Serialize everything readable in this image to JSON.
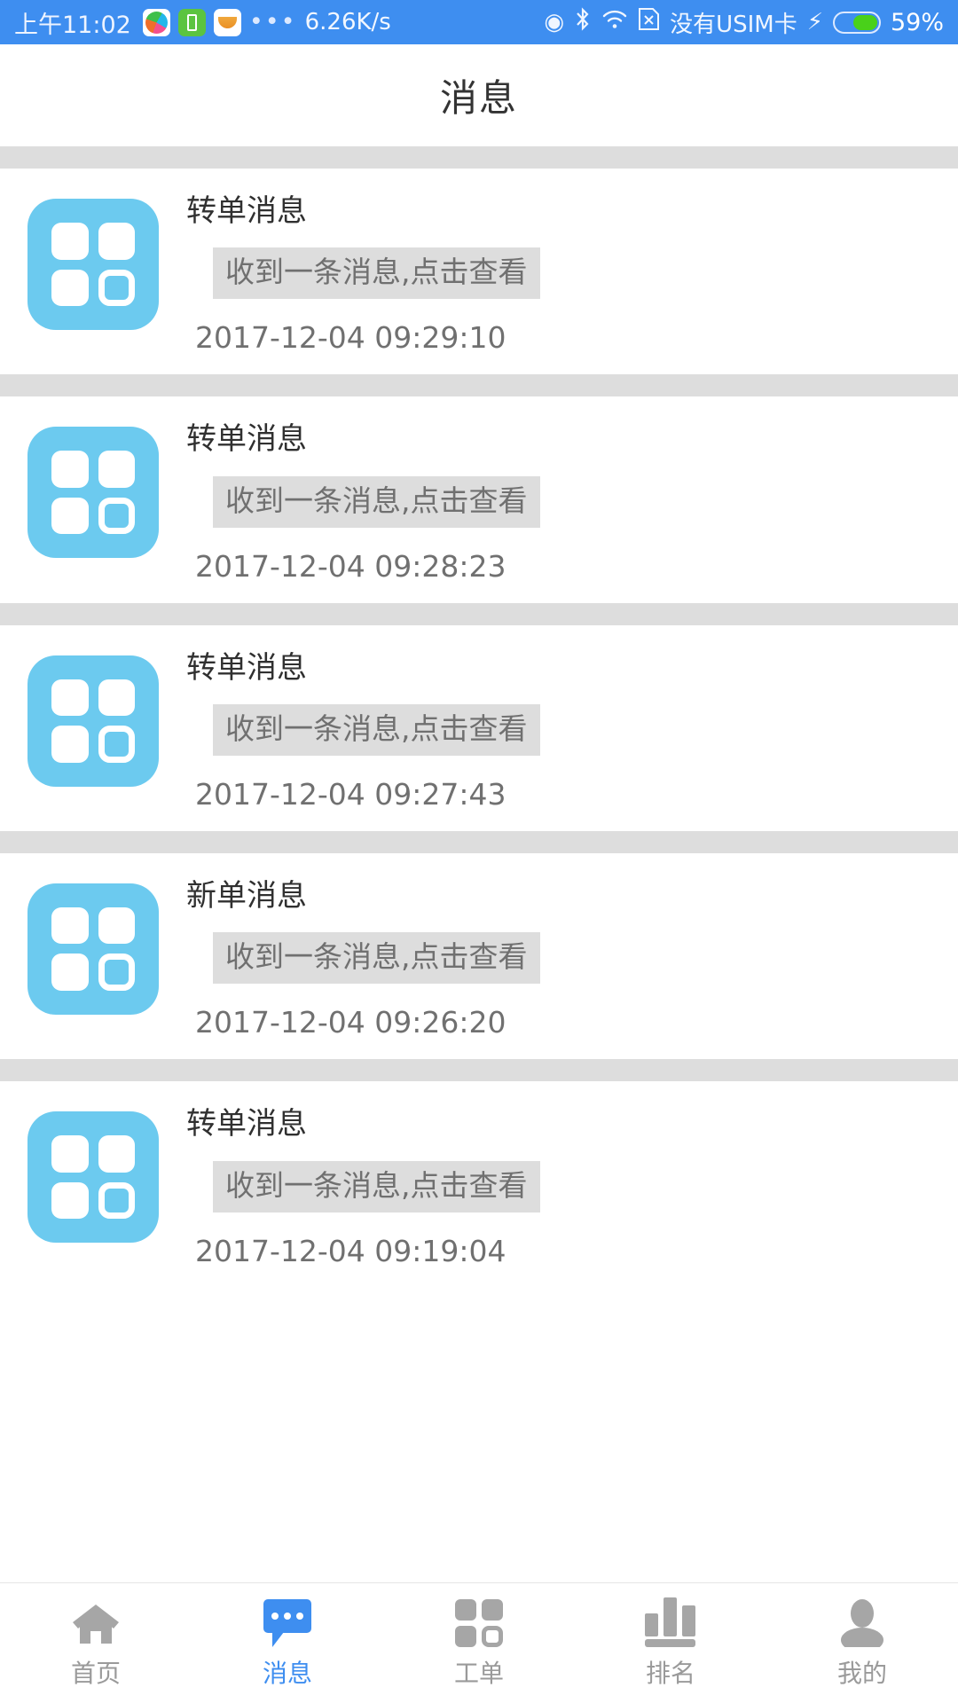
{
  "statusbar": {
    "time": "上午11:02",
    "icons": [
      "color-ball-app-icon",
      "green-battery-app-icon",
      "mail-app-icon"
    ],
    "overflow": "•••",
    "network_speed": "6.26K/s",
    "location_glyph": "◉",
    "bluetooth_glyph": "✚",
    "wifi_glyph": "◬",
    "sim_glyph": "⊠",
    "sim_text": "没有USIM卡",
    "charging_glyph": "⚡",
    "battery_percent": "59%",
    "battery_level": 59,
    "bg_color": "#3e8ef0"
  },
  "header": {
    "title": "消息"
  },
  "messages": [
    {
      "title": "转单消息",
      "body": "收到一条消息,点击查看",
      "time": "2017-12-04 09:29:10",
      "icon": "work-order-grid-icon"
    },
    {
      "title": "转单消息",
      "body": "收到一条消息,点击查看",
      "time": "2017-12-04 09:28:23",
      "icon": "work-order-grid-icon"
    },
    {
      "title": "转单消息",
      "body": "收到一条消息,点击查看",
      "time": "2017-12-04 09:27:43",
      "icon": "work-order-grid-icon"
    },
    {
      "title": "新单消息",
      "body": "收到一条消息,点击查看",
      "time": "2017-12-04 09:26:20",
      "icon": "work-order-grid-icon"
    },
    {
      "title": "转单消息",
      "body": "收到一条消息,点击查看",
      "time": "2017-12-04 09:19:04",
      "icon": "work-order-grid-icon"
    }
  ],
  "tabbar": {
    "items": [
      {
        "label": "首页",
        "icon": "home-icon",
        "active": false
      },
      {
        "label": "消息",
        "icon": "message-bubble-icon",
        "active": true
      },
      {
        "label": "工单",
        "icon": "work-order-grid-icon",
        "active": false
      },
      {
        "label": "排名",
        "icon": "bar-chart-icon",
        "active": false
      },
      {
        "label": "我的",
        "icon": "person-icon",
        "active": false
      }
    ],
    "active_color": "#3e8ef0",
    "inactive_color": "#9a9a9a"
  },
  "colors": {
    "accent": "#3e8ef0",
    "icon_blue": "#6ccaef",
    "divider_gray": "#dddddd"
  }
}
